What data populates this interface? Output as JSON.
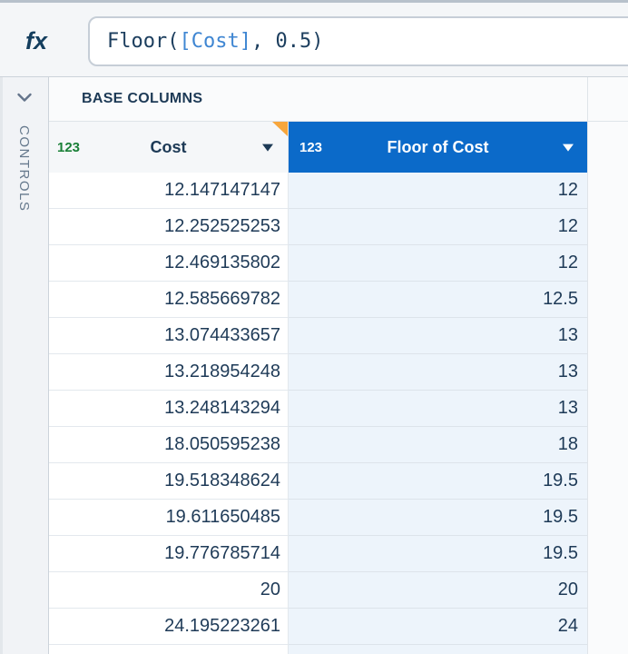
{
  "formula_bar": {
    "fx_label": "fx",
    "function_part": "Floor(",
    "column_ref": "[Cost]",
    "args_part": ", 0.5)"
  },
  "sidebar": {
    "label": "CONTROLS",
    "chevron_icon": "chevron-down-icon"
  },
  "table": {
    "section_label": "BASE COLUMNS",
    "columns": [
      {
        "type_icon": "123",
        "name": "Cost",
        "selected": false
      },
      {
        "type_icon": "123",
        "name": "Floor of Cost",
        "selected": true
      }
    ],
    "rows": [
      {
        "cost": "12.147147147",
        "floor": "12"
      },
      {
        "cost": "12.252525253",
        "floor": "12"
      },
      {
        "cost": "12.469135802",
        "floor": "12"
      },
      {
        "cost": "12.585669782",
        "floor": "12.5"
      },
      {
        "cost": "13.074433657",
        "floor": "13"
      },
      {
        "cost": "13.218954248",
        "floor": "13"
      },
      {
        "cost": "13.248143294",
        "floor": "13"
      },
      {
        "cost": "18.050595238",
        "floor": "18"
      },
      {
        "cost": "19.518348624",
        "floor": "19.5"
      },
      {
        "cost": "19.611650485",
        "floor": "19.5"
      },
      {
        "cost": "19.776785714",
        "floor": "19.5"
      },
      {
        "cost": "20",
        "floor": "20"
      },
      {
        "cost": "24.195223261",
        "floor": "24"
      }
    ]
  },
  "colors": {
    "selected_column_header": "#0b6ac9",
    "selected_column_cell": "#edf4fb",
    "numeric_type_green": "#1a8038",
    "corner_marker_orange": "#f7a63c",
    "column_ref_blue": "#3f86d2"
  }
}
